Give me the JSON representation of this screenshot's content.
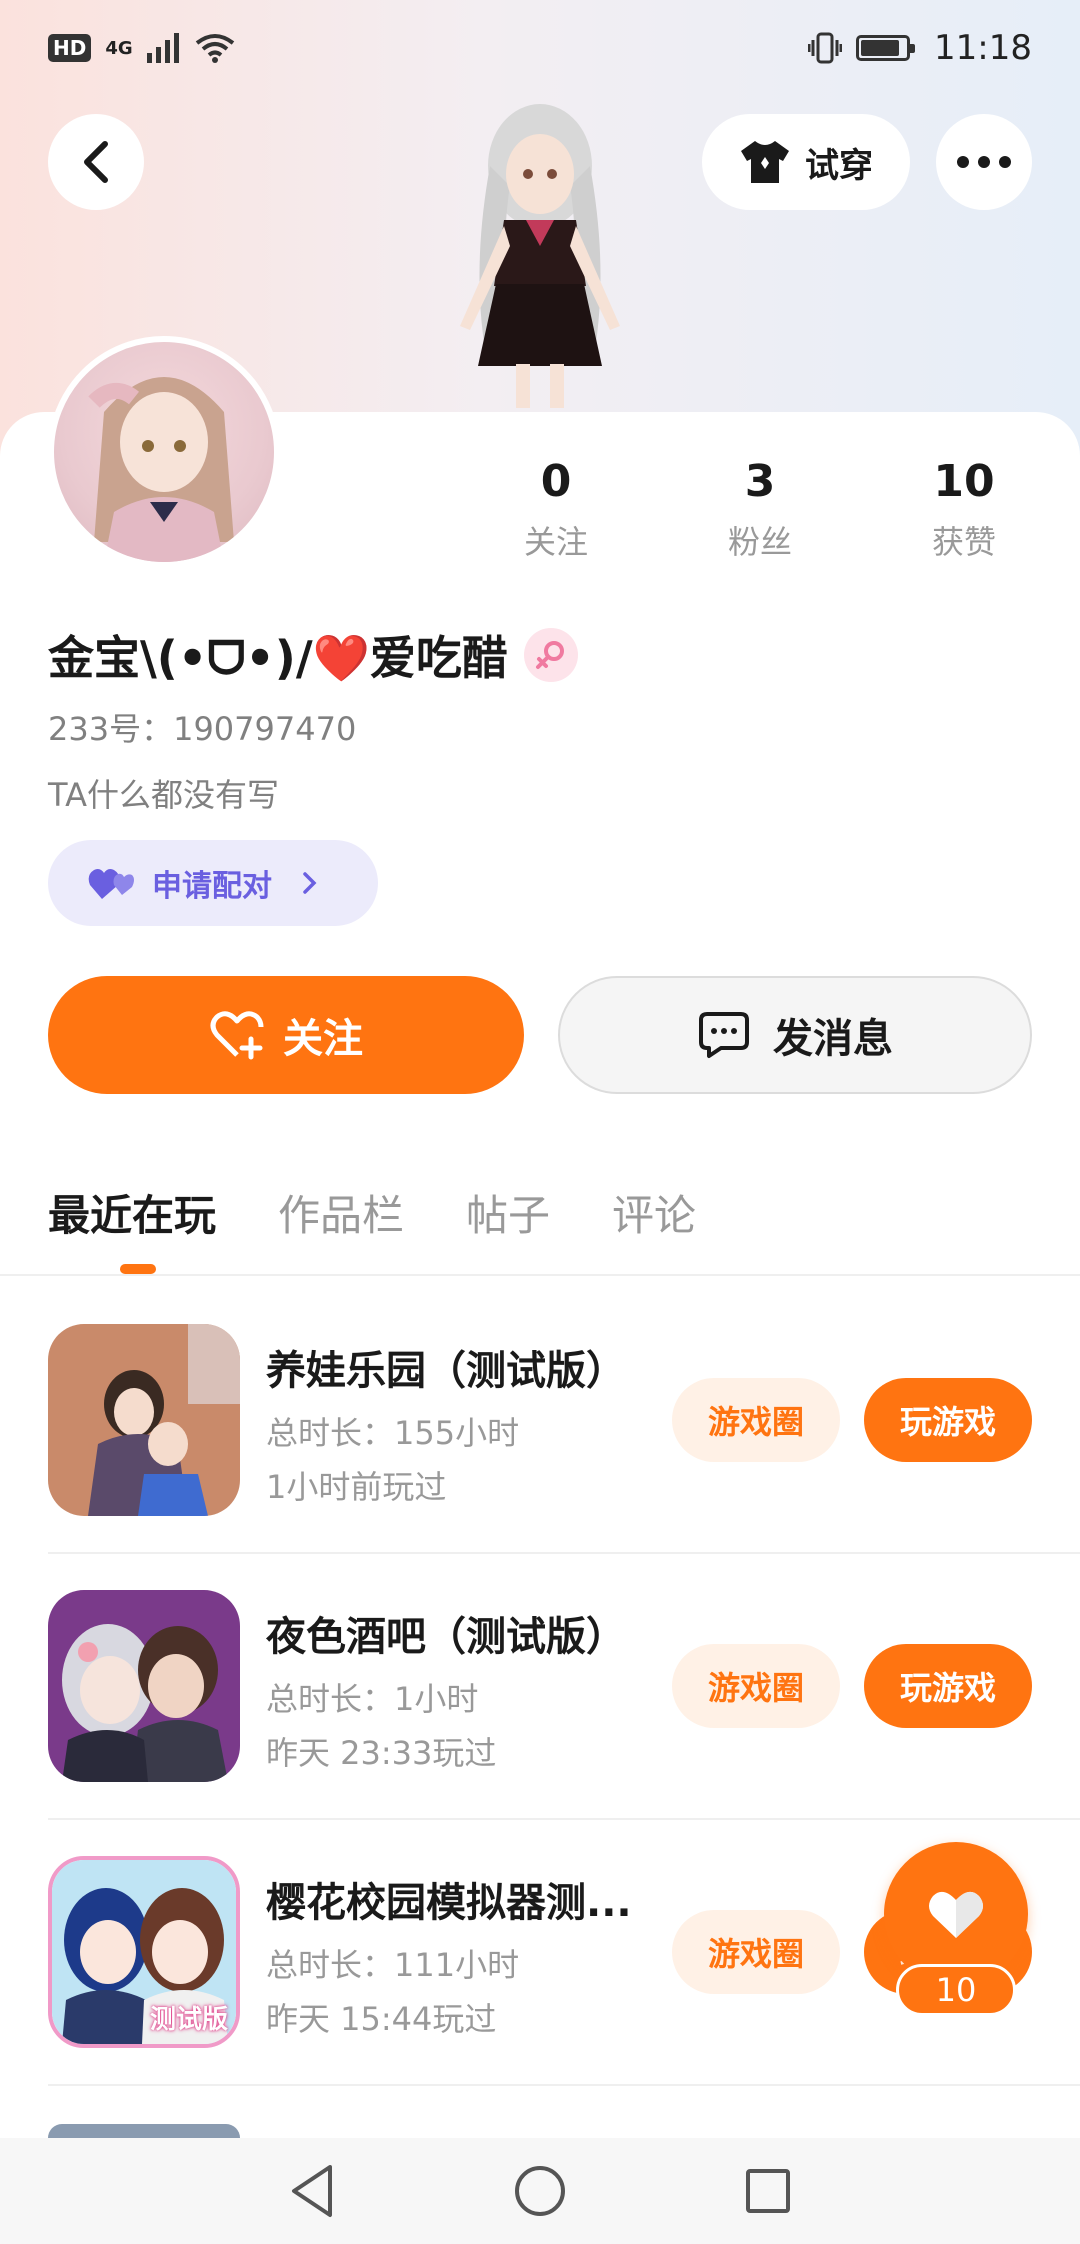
{
  "status_bar": {
    "hd": "HD",
    "network": "4G",
    "time": "11:18"
  },
  "header": {
    "try_on_label": "试穿"
  },
  "profile": {
    "stats": [
      {
        "value": "0",
        "label": "关注"
      },
      {
        "value": "3",
        "label": "粉丝"
      },
      {
        "value": "10",
        "label": "获赞"
      }
    ],
    "nickname": "金宝\\(•ᗜ•)/❤️爱吃醋",
    "uid": "233号：190797470",
    "bio": "TA什么都没有写",
    "pair_label": "申请配对"
  },
  "actions": {
    "follow_label": "关注",
    "message_label": "发消息"
  },
  "tabs": [
    {
      "label": "最近在玩",
      "active": true
    },
    {
      "label": "作品栏",
      "active": false
    },
    {
      "label": "帖子",
      "active": false
    },
    {
      "label": "评论",
      "active": false
    }
  ],
  "games": [
    {
      "title": "养娃乐园（测试版）",
      "duration": "总时长：155小时",
      "last_played": "1小时前玩过",
      "circle_label": "游戏圈",
      "play_label": "玩游戏"
    },
    {
      "title": "夜色酒吧（测试版）",
      "duration": "总时长：1小时",
      "last_played": "昨天 23:33玩过",
      "circle_label": "游戏圈",
      "play_label": "玩游戏"
    },
    {
      "title": "樱花校园模拟器测...",
      "duration": "总时长：111小时",
      "last_played": "昨天 15:44玩过",
      "circle_label": "游戏圈",
      "play_label": "玩游戏",
      "icon_badge": "测试版"
    }
  ],
  "like_fab": {
    "count": "10"
  },
  "colors": {
    "accent": "#ff7411",
    "accent_light": "#fff1e6",
    "pair_bg": "#ecebfb",
    "pair_text": "#6a5fe0"
  }
}
